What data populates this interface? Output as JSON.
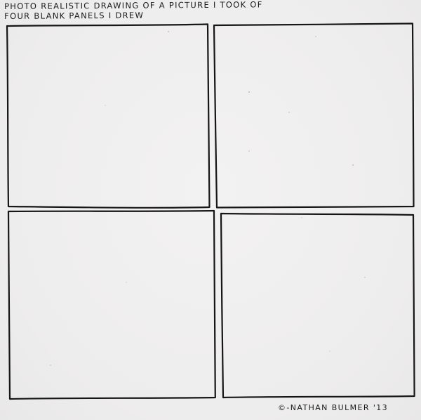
{
  "caption": {
    "line1": "PHOTO REALISTIC DRAWING OF A PICTURE I TOOK OF",
    "line2": "FOUR BLANK PANELS I DREW"
  },
  "signature": "©-NATHAN BULMER '13"
}
